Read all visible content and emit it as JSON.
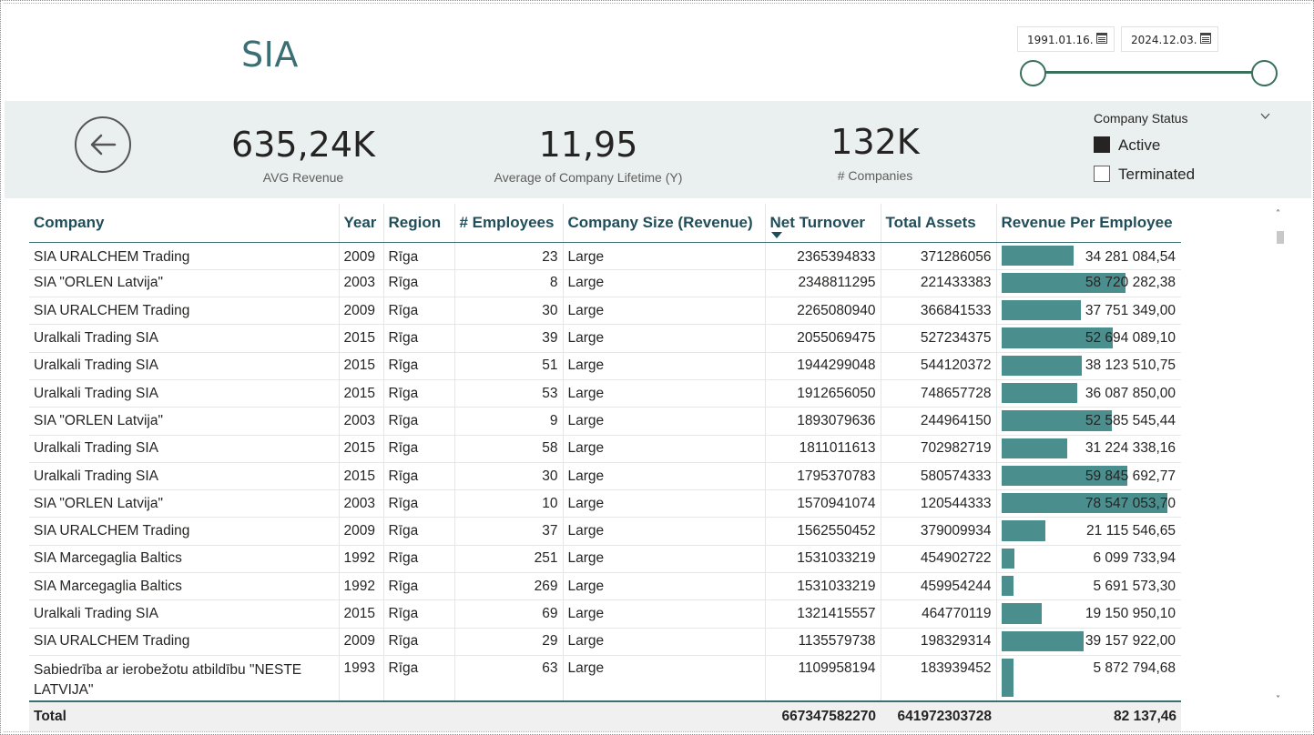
{
  "page": {
    "title": "SIA"
  },
  "date_range": {
    "from": "1991.01.16.",
    "to": "2024.12.03."
  },
  "kpis": [
    {
      "value": "635,24K",
      "label": "AVG Revenue"
    },
    {
      "value": "11,95",
      "label": "Average of Company Lifetime (Y)"
    },
    {
      "value": "132K",
      "label": "# Companies"
    }
  ],
  "status_filter": {
    "title": "Company Status",
    "options": [
      {
        "label": "Active",
        "selected": true
      },
      {
        "label": "Terminated",
        "selected": false
      }
    ]
  },
  "table": {
    "columns": [
      "Company",
      "Year",
      "Region",
      "# Employees",
      "Company Size (Revenue)",
      "Net Turnover",
      "Total Assets",
      "Revenue Per Employee"
    ],
    "sorted_column": "Net Turnover",
    "bar_color": "#4b8e8e",
    "rows": [
      {
        "company": "SIA URALCHEM Trading",
        "year": "2009",
        "region": "Rīga",
        "employees": "23",
        "size": "Large",
        "turnover": "2365394833",
        "assets": "371286056",
        "rpe": "34 281 084,54",
        "rpe_value": 34281084.54
      },
      {
        "company": "SIA \"ORLEN Latvija\"",
        "year": "2003",
        "region": "Rīga",
        "employees": "8",
        "size": "Large",
        "turnover": "2348811295",
        "assets": "221433383",
        "rpe": "58 720 282,38",
        "rpe_value": 58720282.38
      },
      {
        "company": "SIA URALCHEM Trading",
        "year": "2009",
        "region": "Rīga",
        "employees": "30",
        "size": "Large",
        "turnover": "2265080940",
        "assets": "366841533",
        "rpe": "37 751 349,00",
        "rpe_value": 37751349.0
      },
      {
        "company": "Uralkali Trading SIA",
        "year": "2015",
        "region": "Rīga",
        "employees": "39",
        "size": "Large",
        "turnover": "2055069475",
        "assets": "527234375",
        "rpe": "52 694 089,10",
        "rpe_value": 52694089.1
      },
      {
        "company": "Uralkali Trading SIA",
        "year": "2015",
        "region": "Rīga",
        "employees": "51",
        "size": "Large",
        "turnover": "1944299048",
        "assets": "544120372",
        "rpe": "38 123 510,75",
        "rpe_value": 38123510.75
      },
      {
        "company": "Uralkali Trading SIA",
        "year": "2015",
        "region": "Rīga",
        "employees": "53",
        "size": "Large",
        "turnover": "1912656050",
        "assets": "748657728",
        "rpe": "36 087 850,00",
        "rpe_value": 36087850.0
      },
      {
        "company": "SIA \"ORLEN Latvija\"",
        "year": "2003",
        "region": "Rīga",
        "employees": "9",
        "size": "Large",
        "turnover": "1893079636",
        "assets": "244964150",
        "rpe": "52 585 545,44",
        "rpe_value": 52585545.44
      },
      {
        "company": "Uralkali Trading SIA",
        "year": "2015",
        "region": "Rīga",
        "employees": "58",
        "size": "Large",
        "turnover": "1811011613",
        "assets": "702982719",
        "rpe": "31 224 338,16",
        "rpe_value": 31224338.16
      },
      {
        "company": "Uralkali Trading SIA",
        "year": "2015",
        "region": "Rīga",
        "employees": "30",
        "size": "Large",
        "turnover": "1795370783",
        "assets": "580574333",
        "rpe": "59 845 692,77",
        "rpe_value": 59845692.77
      },
      {
        "company": "SIA \"ORLEN Latvija\"",
        "year": "2003",
        "region": "Rīga",
        "employees": "10",
        "size": "Large",
        "turnover": "1570941074",
        "assets": "120544333",
        "rpe": "78 547 053,70",
        "rpe_value": 78547053.7
      },
      {
        "company": "SIA URALCHEM Trading",
        "year": "2009",
        "region": "Rīga",
        "employees": "37",
        "size": "Large",
        "turnover": "1562550452",
        "assets": "379009934",
        "rpe": "21 115 546,65",
        "rpe_value": 21115546.65
      },
      {
        "company": "SIA Marcegaglia Baltics",
        "year": "1992",
        "region": "Rīga",
        "employees": "251",
        "size": "Large",
        "turnover": "1531033219",
        "assets": "454902722",
        "rpe": "6 099 733,94",
        "rpe_value": 6099733.94
      },
      {
        "company": "SIA Marcegaglia Baltics",
        "year": "1992",
        "region": "Rīga",
        "employees": "269",
        "size": "Large",
        "turnover": "1531033219",
        "assets": "459954244",
        "rpe": "5 691 573,30",
        "rpe_value": 5691573.3
      },
      {
        "company": "Uralkali Trading SIA",
        "year": "2015",
        "region": "Rīga",
        "employees": "69",
        "size": "Large",
        "turnover": "1321415557",
        "assets": "464770119",
        "rpe": "19 150 950,10",
        "rpe_value": 19150950.1
      },
      {
        "company": "SIA URALCHEM Trading",
        "year": "2009",
        "region": "Rīga",
        "employees": "29",
        "size": "Large",
        "turnover": "1135579738",
        "assets": "198329314",
        "rpe": "39 157 922,00",
        "rpe_value": 39157922.0
      },
      {
        "company": "Sabiedrība ar ierobežotu atbildību \"NESTE LATVIJA\"",
        "year": "1993",
        "region": "Rīga",
        "employees": "63",
        "size": "Large",
        "turnover": "1109958194",
        "assets": "183939452",
        "rpe": "5 872 794,68",
        "rpe_value": 5872794.68
      }
    ],
    "total": {
      "label": "Total",
      "turnover": "667347582270",
      "assets": "641972303728",
      "rpe": "82 137,46"
    }
  }
}
